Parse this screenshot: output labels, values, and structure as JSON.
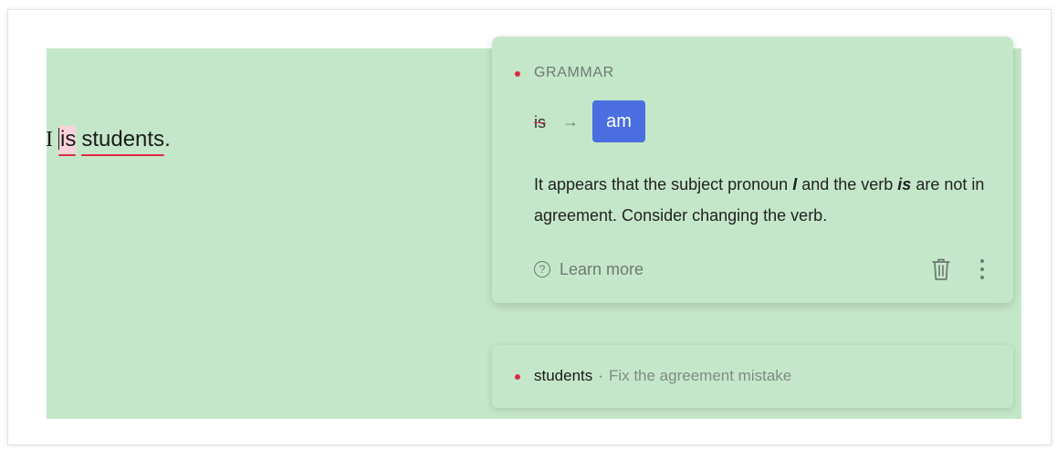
{
  "document": {
    "word_i": "I",
    "word_is": "is",
    "word_students": "students",
    "punct": "."
  },
  "active_card": {
    "category": "GRAMMAR",
    "original": "is",
    "arrow": "→",
    "suggestion": "am",
    "explain_prefix": "It appears that the subject pronoun ",
    "explain_subject": "I",
    "explain_mid": " and the verb ",
    "explain_verb": "is",
    "explain_suffix": " are not in agreement. Consider changing the verb.",
    "learn_more": "Learn more"
  },
  "collapsed_card": {
    "word": "students",
    "separator": "·",
    "hint": "Fix the agreement mistake"
  },
  "colors": {
    "editor_bg": "#c5e7c9",
    "error_red": "#e02944",
    "accent_blue": "#4a6ee0"
  },
  "icons": {
    "help": "question-circle-icon",
    "delete": "trash-icon",
    "more": "kebab-menu-icon"
  }
}
